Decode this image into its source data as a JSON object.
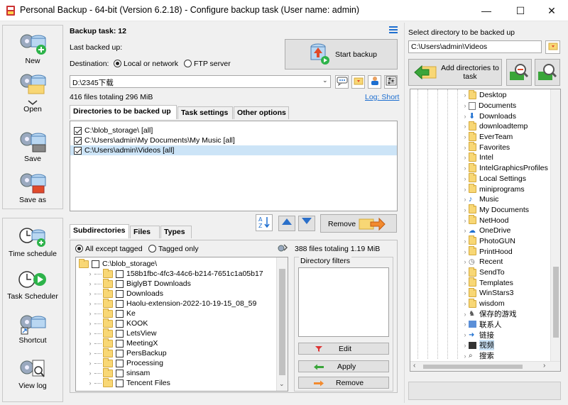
{
  "window": {
    "title": "Personal Backup - 64-bit (Version 6.2.18) - Configure backup task (User name: admin)",
    "minimize_glyph": "—",
    "maximize_glyph": "☐",
    "close_glyph": "✕"
  },
  "sidebar": {
    "top": [
      {
        "label": "New",
        "icon": "new-task-icon"
      },
      {
        "label": "Open",
        "icon": "open-task-icon"
      },
      {
        "label": "Save",
        "icon": "save-task-icon"
      },
      {
        "label": "Save as",
        "icon": "save-as-icon"
      }
    ],
    "bottom": [
      {
        "label": "Time schedule",
        "icon": "time-schedule-icon"
      },
      {
        "label": "Task Scheduler",
        "icon": "task-scheduler-icon"
      },
      {
        "label": "Shortcut",
        "icon": "shortcut-icon"
      },
      {
        "label": "View log",
        "icon": "view-log-icon"
      }
    ]
  },
  "task": {
    "title": "Backup task: 12",
    "last_backed_up": "Last backed up:",
    "destination_label": "Destination:",
    "dest_local": "Local or network",
    "dest_ftp": "FTP server",
    "dest_selected": "local",
    "dest_path": "D:\\2345下载",
    "files_info": "416 files totaling 296 MiB",
    "log_link": "Log: Short",
    "start_backup": "Start backup"
  },
  "tabs_top": [
    "Directories to be backed up",
    "Task settings",
    "Other options"
  ],
  "backup_dirs": [
    {
      "path": "C:\\blob_storage\\ [all]",
      "checked": true,
      "selected": false
    },
    {
      "path": "C:\\Users\\admin\\My Documents\\My Music [all]",
      "checked": true,
      "selected": false
    },
    {
      "path": "C:\\Users\\admin\\Videos [all]",
      "checked": true,
      "selected": true
    }
  ],
  "remove_label": "Remove",
  "tabs_bottom": [
    "Subdirectories",
    "Files",
    "Types"
  ],
  "subdir_options": {
    "all_except": "All except tagged",
    "tagged_only": "Tagged only",
    "selected": "all_except",
    "count": "388 files totaling 1.19 MiB"
  },
  "subdir_root": "C:\\blob_storage\\",
  "subdirs": [
    "158b1fbc-4fc3-44c6-b214-7651c1a05b17",
    "BiglyBT Downloads",
    "Downloads",
    "Haolu-extension-2022-10-19-15_08_59",
    "Ke",
    "KOOK",
    "LetsView",
    "MeetingX",
    "PersBackup",
    "Processing",
    "sinsam",
    "Tencent Files"
  ],
  "dir_filters": {
    "title": "Directory filters",
    "edit": "Edit",
    "apply": "Apply",
    "remove": "Remove"
  },
  "right": {
    "label": "Select directory to be backed up",
    "path": "C:\\Users\\admin\\Videos",
    "add_button": "Add directories to task",
    "tree": [
      "Desktop",
      "Documents",
      "Downloads",
      "downloadtemp",
      "EverTeam",
      "Favorites",
      "Intel",
      "IntelGraphicsProfiles",
      "Local Settings",
      "miniprograms",
      "Music",
      "My Documents",
      "NetHood",
      "OneDrive",
      "PhotoGUN",
      "PrintHood",
      "Recent",
      "SendTo",
      "Templates",
      "WinStars3",
      "wisdom",
      "保存的游戏",
      "联系人",
      "链接",
      "视频",
      "搜索"
    ],
    "selected_index": 24
  },
  "colors": {
    "accent_blue": "#1e6fd0",
    "selection": "#cce4f7",
    "folder_yellow": "#f8d775"
  }
}
